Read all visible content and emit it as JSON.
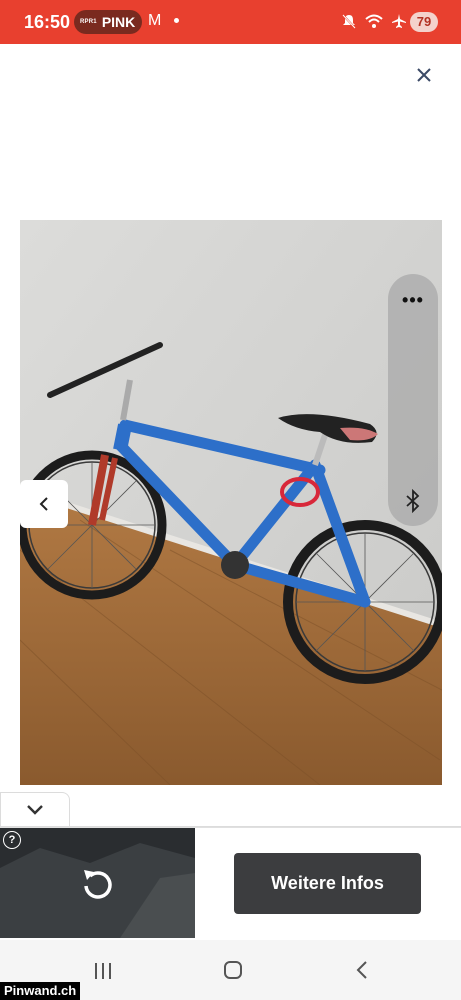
{
  "status_bar": {
    "time": "16:50",
    "radio_small": "RPR1",
    "radio_name": "PINK",
    "mail_glyph": "M",
    "battery": "79",
    "background": "#e8402f"
  },
  "ad": {
    "cta_label": "Weitere Infos",
    "help_glyph": "?"
  },
  "watermark": "Pinwand.ch",
  "icons": [
    "close-icon",
    "chevron-left-icon",
    "more-dots-icon",
    "bluetooth-icon",
    "chevron-down-icon",
    "replay-icon",
    "recents-icon",
    "home-icon",
    "back-icon",
    "mute-icon",
    "wifi-icon",
    "airplane-icon"
  ],
  "colors": {
    "accent": "#e8402f",
    "bike_frame": "#2d6fc9",
    "cta_background": "#3c3d3f"
  }
}
